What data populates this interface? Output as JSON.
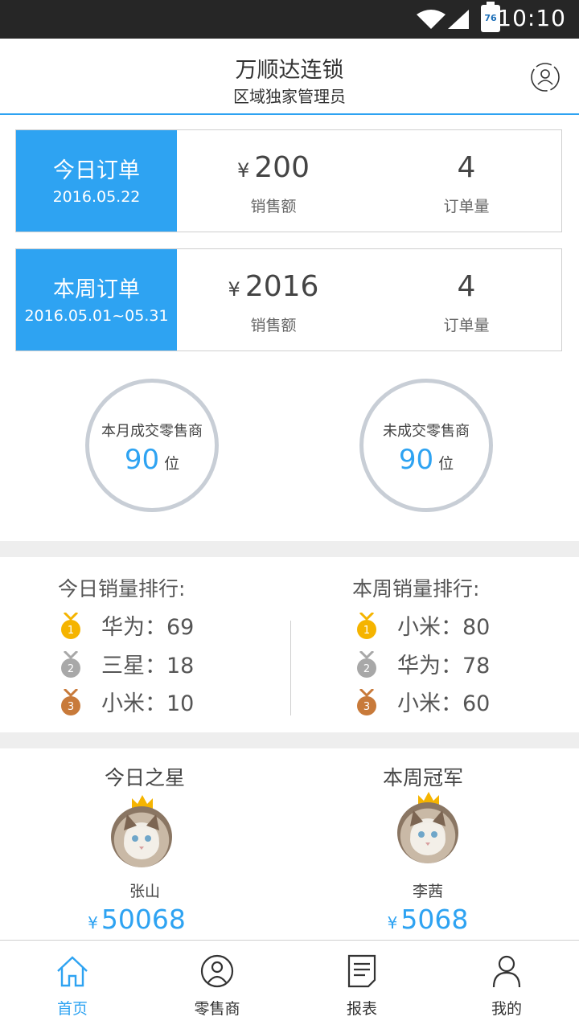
{
  "status_bar": {
    "time": "10:10",
    "battery": "76"
  },
  "header": {
    "title": "万顺达连锁",
    "subtitle": "区域独家管理员",
    "user_icon": "user-settings-icon"
  },
  "today_order": {
    "label": "今日订单",
    "date": "2016.05.22",
    "currency": "¥",
    "amount": "200",
    "amount_caption": "销售额",
    "count": "4",
    "count_caption": "订单量"
  },
  "week_order": {
    "label": "本周订单",
    "date": "2016.05.01~05.31",
    "currency": "¥",
    "amount": "2016",
    "amount_caption": "销售额",
    "count": "4",
    "count_caption": "订单量"
  },
  "circles": [
    {
      "caption": "本月成交零售商",
      "value": "90",
      "unit": "位"
    },
    {
      "caption": "未成交零售商",
      "value": "90",
      "unit": "位"
    }
  ],
  "ranking": {
    "today": {
      "title": "今日销量排行:",
      "items": [
        {
          "rank": 1,
          "medal": "gold-medal-icon",
          "text": "华为：69"
        },
        {
          "rank": 2,
          "medal": "silver-medal-icon",
          "text": "三星：18"
        },
        {
          "rank": 3,
          "medal": "bronze-medal-icon",
          "text": "小米：10"
        }
      ]
    },
    "week": {
      "title": "本周销量排行:",
      "items": [
        {
          "rank": 1,
          "medal": "gold-medal-icon",
          "text": "小米：80"
        },
        {
          "rank": 2,
          "medal": "silver-medal-icon",
          "text": "华为：78"
        },
        {
          "rank": 3,
          "medal": "bronze-medal-icon",
          "text": "小米：60"
        }
      ]
    }
  },
  "stars": [
    {
      "title": "今日之星",
      "name": "张山",
      "currency": "¥",
      "amount": "50068"
    },
    {
      "title": "本周冠军",
      "name": "李茜",
      "currency": "¥",
      "amount": "5068"
    }
  ],
  "tabbar": {
    "items": [
      {
        "label": "首页",
        "icon": "home-icon",
        "active": true
      },
      {
        "label": "零售商",
        "icon": "retailer-icon",
        "active": false
      },
      {
        "label": "报表",
        "icon": "report-icon",
        "active": false
      },
      {
        "label": "我的",
        "icon": "profile-icon",
        "active": false
      }
    ]
  },
  "colors": {
    "accent": "#2ea3f2",
    "gold": "#f5b400",
    "silver": "#a8a8a8",
    "bronze": "#c87a3a"
  }
}
